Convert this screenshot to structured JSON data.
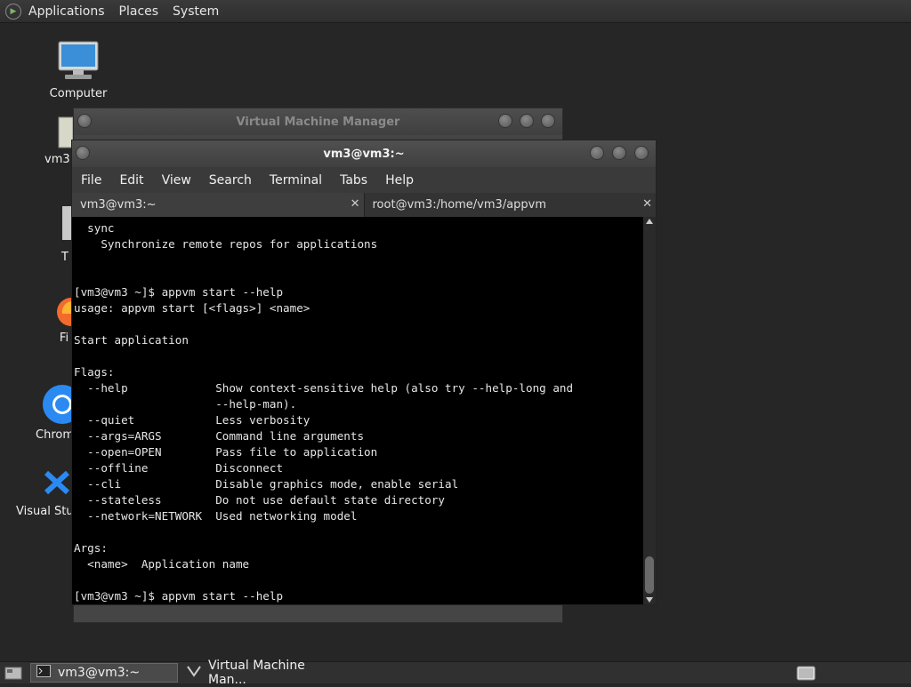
{
  "top_panel": {
    "menus": [
      "Applications",
      "Places",
      "System"
    ]
  },
  "desktop_icons": [
    {
      "label": "Computer"
    },
    {
      "label": "vm3"
    },
    {
      "label": "T"
    },
    {
      "label": "Fi"
    },
    {
      "label": "Chrom"
    },
    {
      "label": "Visual Stud"
    }
  ],
  "vmm_window": {
    "title": "Virtual Machine Manager"
  },
  "terminal_window": {
    "title": "vm3@vm3:~",
    "menu": [
      "File",
      "Edit",
      "View",
      "Search",
      "Terminal",
      "Tabs",
      "Help"
    ],
    "tabs": [
      {
        "label": "vm3@vm3:~",
        "close": "✕"
      },
      {
        "label": "root@vm3:/home/vm3/appvm",
        "close": "✕"
      }
    ],
    "output": "  sync\n    Synchronize remote repos for applications\n\n\n[vm3@vm3 ~]$ appvm start --help\nusage: appvm start [<flags>] <name>\n\nStart application\n\nFlags:\n  --help             Show context-sensitive help (also try --help-long and\n                     --help-man).\n  --quiet            Less verbosity\n  --args=ARGS        Command line arguments\n  --open=OPEN        Pass file to application\n  --offline          Disconnect\n  --cli              Disable graphics mode, enable serial\n  --stateless        Do not use default state directory\n  --network=NETWORK  Used networking model\n\nArgs:\n  <name>  Application name\n\n[vm3@vm3 ~]$ appvm start --help"
  },
  "taskbar": {
    "tasks": [
      {
        "label": "vm3@vm3:~"
      },
      {
        "label": "Virtual Machine Man..."
      }
    ]
  },
  "colors": {
    "desktop_bg": "#262626",
    "terminal_bg": "#000000",
    "terminal_fg": "#e6e6e6"
  }
}
